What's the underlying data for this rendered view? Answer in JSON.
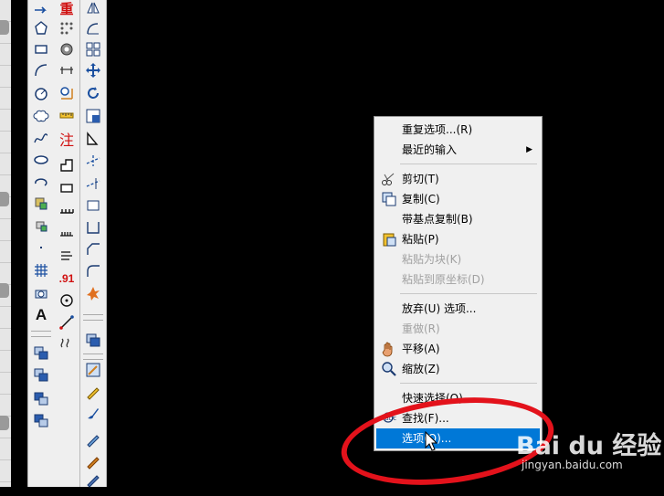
{
  "canvas": {
    "background": "#000000"
  },
  "toolbars": {
    "col1": [
      {
        "icon": "polyline-arrow-icon"
      },
      {
        "icon": "polygon-icon"
      },
      {
        "icon": "rectangle-icon"
      },
      {
        "icon": "arc-icon"
      },
      {
        "icon": "circle-icon"
      },
      {
        "icon": "revision-cloud-icon"
      },
      {
        "icon": "spline-icon"
      },
      {
        "icon": "ellipse-icon"
      },
      {
        "icon": "ellipse-arc-icon"
      },
      {
        "icon": "insert-block-icon"
      },
      {
        "icon": "make-block-icon"
      },
      {
        "icon": "point-icon"
      },
      {
        "icon": "hatch-icon"
      },
      {
        "icon": "region-icon"
      },
      {
        "icon": "text-icon",
        "text": "A"
      },
      {
        "icon": "layer-stack-icon"
      },
      {
        "icon": "layer-stack-icon"
      },
      {
        "icon": "layer-stack-icon"
      },
      {
        "icon": "layer-stack-icon"
      }
    ],
    "col2": [
      {
        "icon": "heavy-text-icon",
        "text": "重"
      },
      {
        "icon": "dots-grid-icon"
      },
      {
        "icon": "gear-camera-icon"
      },
      {
        "icon": "dimension-line-icon"
      },
      {
        "icon": "measure-icon"
      },
      {
        "icon": "ruler-icon"
      },
      {
        "icon": "annotation-icon",
        "text": "注"
      },
      {
        "icon": "step-shape-icon"
      },
      {
        "icon": "rect-outline-icon"
      },
      {
        "icon": "comb-icon"
      },
      {
        "icon": "comb-icon"
      },
      {
        "icon": "text-align-icon"
      },
      {
        "icon": "decimal-icon",
        "text": ".91"
      },
      {
        "icon": "center-mark-icon"
      },
      {
        "icon": "leader-icon"
      },
      {
        "icon": "break-line-icon"
      }
    ],
    "col3": [
      {
        "icon": "mirror-icon"
      },
      {
        "icon": "offset-icon"
      },
      {
        "icon": "array-icon"
      },
      {
        "icon": "move-icon"
      },
      {
        "icon": "rotate-icon"
      },
      {
        "icon": "scale-icon"
      },
      {
        "icon": "stretch-icon"
      },
      {
        "icon": "trim-icon"
      },
      {
        "icon": "extend-icon"
      },
      {
        "icon": "break-icon"
      },
      {
        "icon": "join-icon"
      },
      {
        "icon": "chamfer-icon"
      },
      {
        "icon": "fillet-icon"
      },
      {
        "icon": "explode-icon"
      },
      {
        "icon": "layer-stack-icon"
      },
      {
        "icon": "edit-pencil-icon"
      },
      {
        "icon": "pencil-icon"
      },
      {
        "icon": "brush-icon"
      },
      {
        "icon": "brush-icon"
      },
      {
        "icon": "brush-icon"
      }
    ]
  },
  "context_menu": {
    "items": [
      {
        "label": "重复选项...(R)",
        "enabled": true
      },
      {
        "label": "最近的输入",
        "enabled": true,
        "submenu": true,
        "arrow": "▶"
      },
      {
        "label": "剪切(T)",
        "enabled": true,
        "icon": "scissors-icon"
      },
      {
        "label": "复制(C)",
        "enabled": true,
        "icon": "copy-icon"
      },
      {
        "label": "带基点复制(B)",
        "enabled": true
      },
      {
        "label": "粘贴(P)",
        "enabled": true,
        "icon": "paste-icon"
      },
      {
        "label": "粘贴为块(K)",
        "enabled": false
      },
      {
        "label": "粘贴到原坐标(D)",
        "enabled": false
      },
      {
        "label": "放弃(U) 选项...",
        "enabled": true
      },
      {
        "label": "重做(R)",
        "enabled": false
      },
      {
        "label": "平移(A)",
        "enabled": true,
        "icon": "pan-hand-icon"
      },
      {
        "label": "缩放(Z)",
        "enabled": true,
        "icon": "zoom-icon"
      },
      {
        "label": "快速选择(Q)...",
        "enabled": true
      },
      {
        "label": "查找(F)...",
        "enabled": true,
        "icon": "find-icon"
      },
      {
        "label": "选项(O)...",
        "enabled": true,
        "selected": true
      }
    ]
  },
  "highlight": {
    "color": "#e3121b"
  },
  "selection_color": "#0078d7",
  "watermark": {
    "brand": "Bai du 经验",
    "url": "jingyan.baidu.com"
  }
}
